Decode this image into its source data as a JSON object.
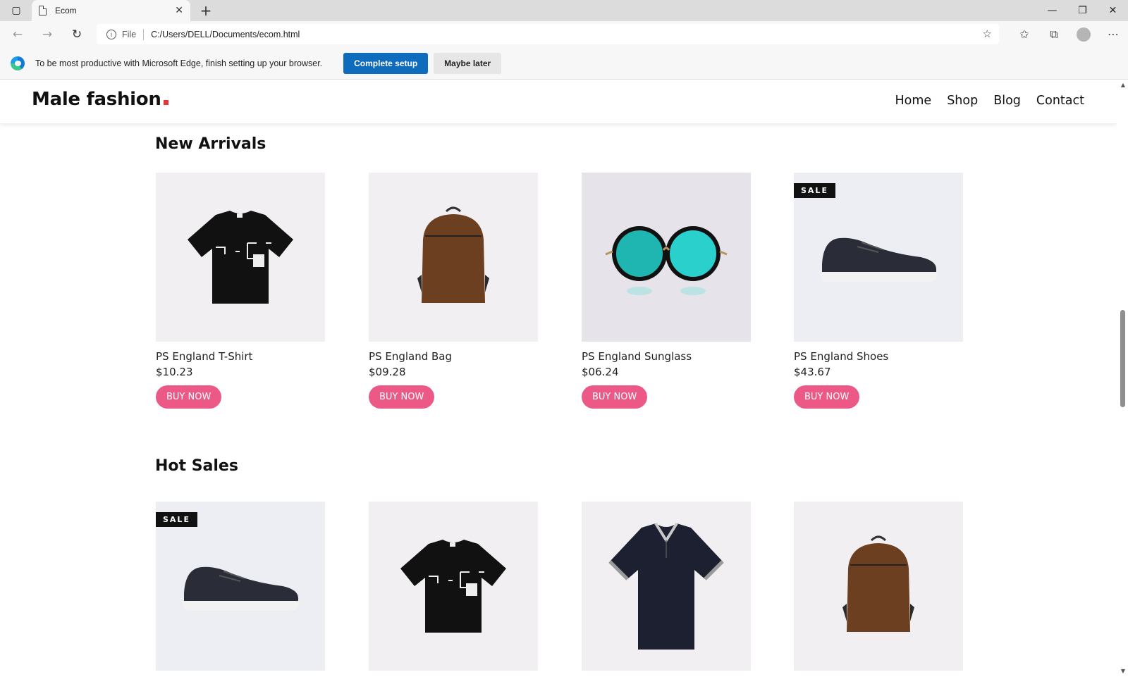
{
  "browser": {
    "tab_title": "Ecom",
    "file_label": "File",
    "url": "C:/Users/DELL/Documents/ecom.html",
    "infobar_text": "To be most productive with Microsoft Edge, finish setting up your browser.",
    "complete_setup": "Complete setup",
    "maybe_later": "Maybe later"
  },
  "site": {
    "logo_text": "Male fashion",
    "nav": [
      "Home",
      "Shop",
      "Blog",
      "Contact"
    ]
  },
  "new_arrivals": {
    "title": "New Arrivals",
    "products": [
      {
        "name": "PS England T-Shirt",
        "price": "$10.23",
        "button": "BUY NOW",
        "image": "tshirt"
      },
      {
        "name": "PS England Bag",
        "price": "$09.28",
        "button": "BUY NOW",
        "image": "bag"
      },
      {
        "name": "PS England Sunglass",
        "price": "$06.24",
        "button": "BUY NOW",
        "image": "sunglass"
      },
      {
        "name": "PS England Shoes",
        "price": "$43.67",
        "button": "BUY NOW",
        "image": "shoes",
        "badge": "SALE"
      }
    ]
  },
  "hot_sales": {
    "title": "Hot Sales",
    "products": [
      {
        "image": "shoes",
        "badge": "SALE"
      },
      {
        "image": "tshirt"
      },
      {
        "image": "polo"
      },
      {
        "image": "bag"
      }
    ]
  },
  "colors": {
    "accent": "#ec5987",
    "logo_dot": "#e53637",
    "edge_blue": "#0f6cbd"
  }
}
